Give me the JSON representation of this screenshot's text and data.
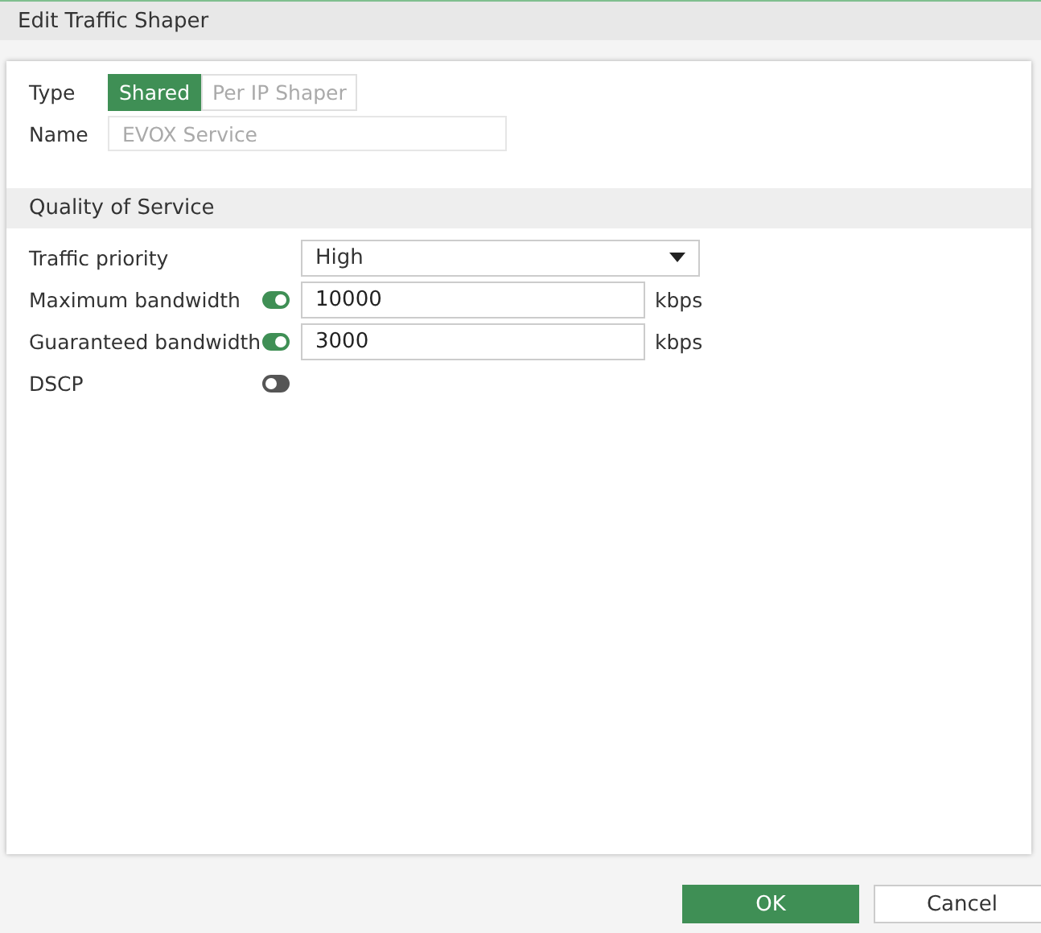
{
  "window": {
    "title": "Edit Traffic Shaper"
  },
  "type": {
    "label": "Type",
    "options": [
      {
        "label": "Shared",
        "selected": true
      },
      {
        "label": "Per IP Shaper",
        "selected": false
      }
    ]
  },
  "name": {
    "label": "Name",
    "placeholder": "EVOX Service"
  },
  "qos": {
    "title": "Quality of Service",
    "rows": [
      {
        "kind": "select",
        "label": "Traffic priority",
        "value": "High"
      },
      {
        "kind": "input",
        "label": "Maximum bandwidth",
        "on": true,
        "value": "10000",
        "unit": "kbps"
      },
      {
        "kind": "input",
        "label": "Guaranteed bandwidth",
        "on": true,
        "value": "3000",
        "unit": "kbps"
      },
      {
        "kind": "toggle",
        "label": "DSCP",
        "on": false
      }
    ]
  },
  "buttons": [
    {
      "label": "OK",
      "kind": "primary"
    },
    {
      "label": "Cancel",
      "kind": "secondary"
    }
  ]
}
